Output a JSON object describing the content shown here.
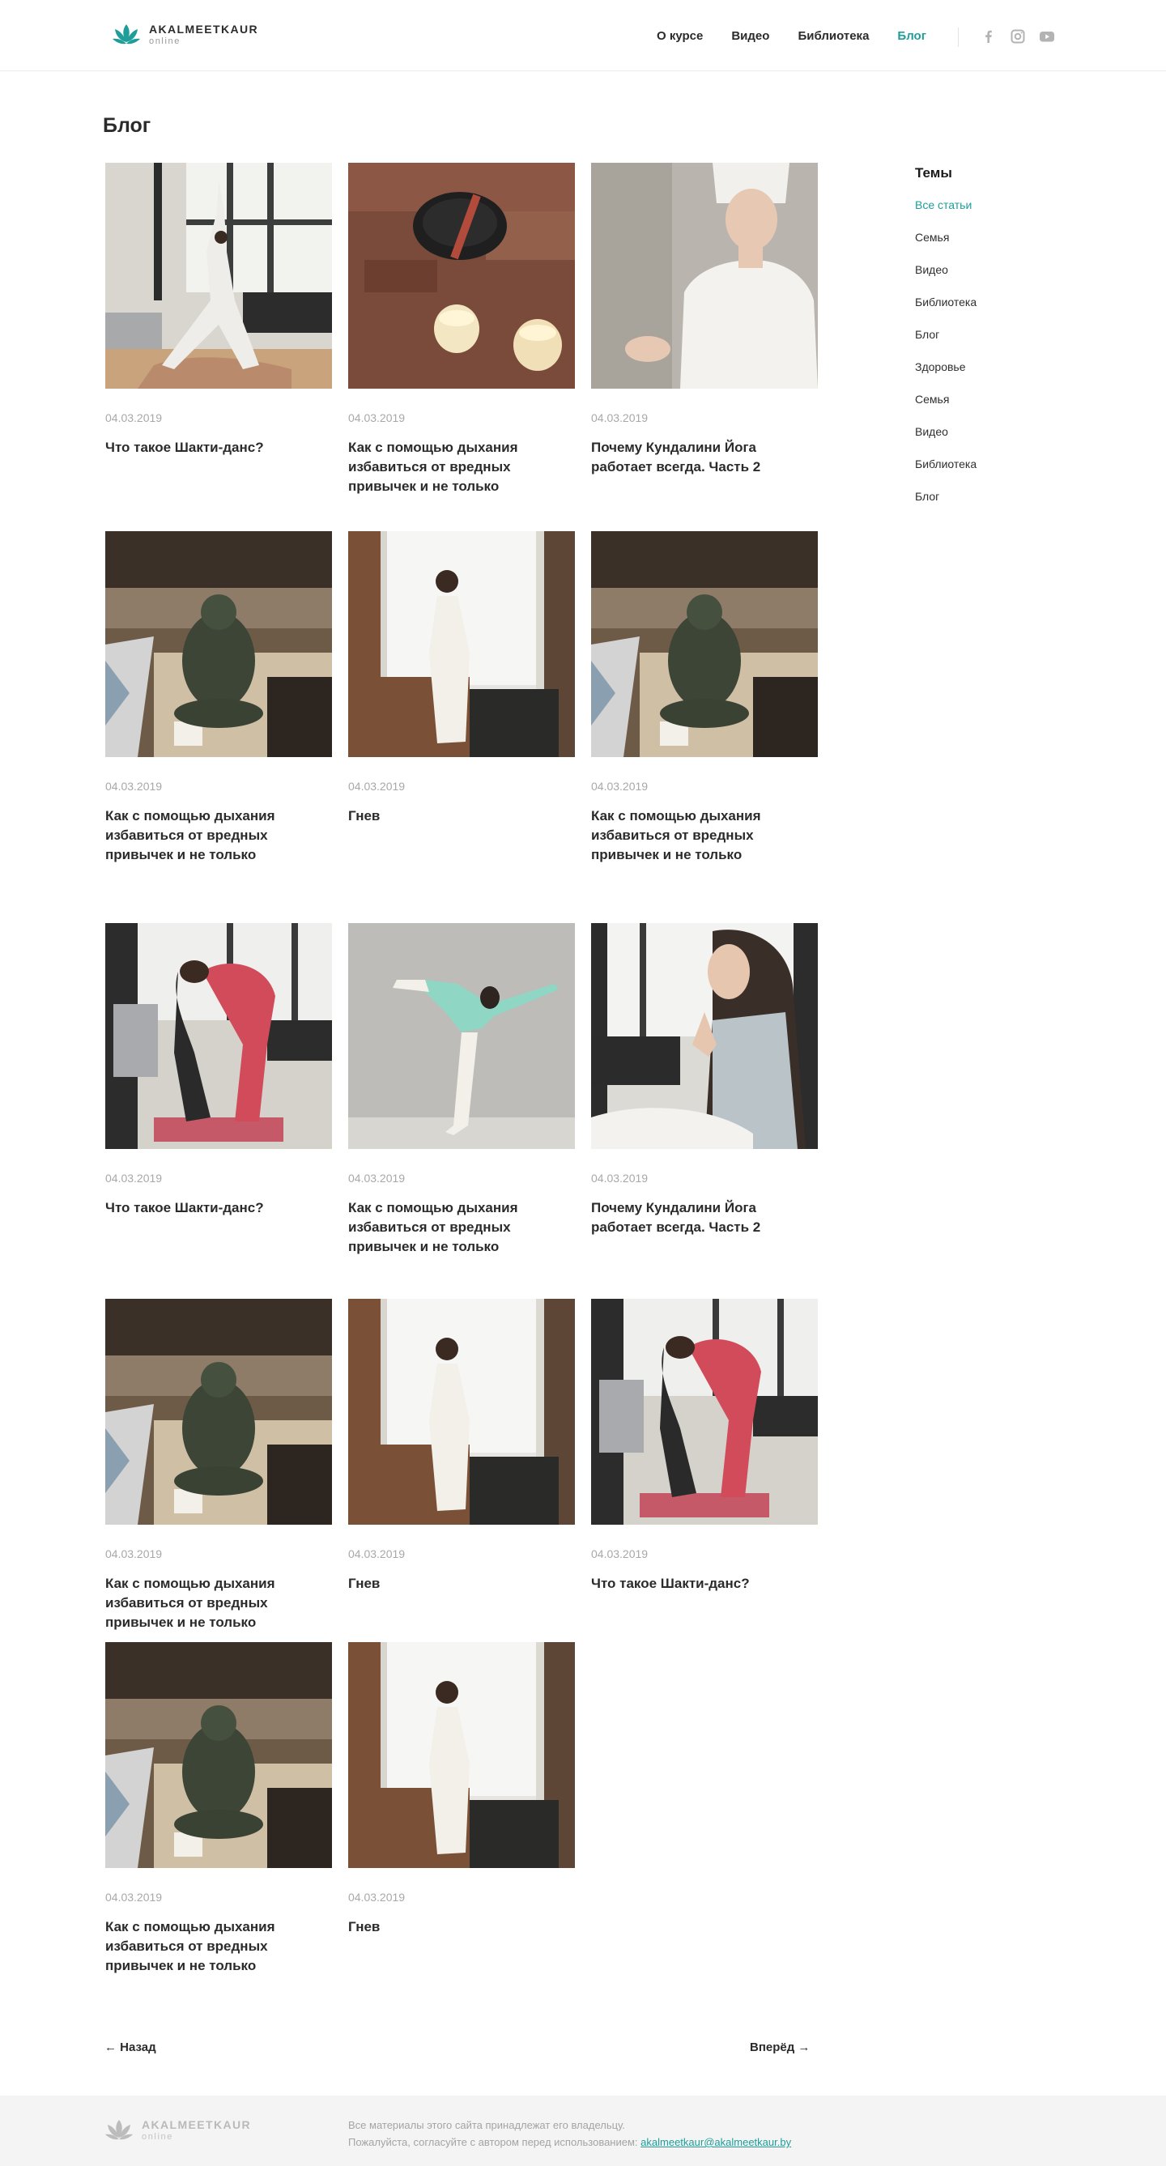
{
  "header": {
    "logo_name": "AKALMEETKAUR",
    "logo_sub": "online",
    "nav": [
      "О курсе",
      "Видео",
      "Библиотека",
      "Блог"
    ],
    "active_nav": "Блог",
    "social_icons": [
      "facebook-icon",
      "instagram-icon",
      "youtube-icon"
    ],
    "accent_color": "#1f9e99"
  },
  "page_title": "Блог",
  "posts": [
    {
      "date": "04.03.2019",
      "title": "Что такое Шакти-данс?",
      "image": "yoga-warrior-pose-photo"
    },
    {
      "date": "04.03.2019",
      "title": "Как с помощью дыхания избавиться от вредных привычек и не только",
      "image": "singing-bowl-candles-photo"
    },
    {
      "date": "04.03.2019",
      "title": "Почему Кундалини Йога работает всегда. Часть 2",
      "image": "woman-white-turban-photo"
    },
    {
      "date": "04.03.2019",
      "title": "Как с помощью дыхания избавиться от вредных привычек и не только",
      "image": "ganesha-statue-photo"
    },
    {
      "date": "04.03.2019",
      "title": "Гнев",
      "image": "woman-by-window-photo"
    },
    {
      "date": "04.03.2019",
      "title": "Как с помощью дыхания избавиться от вредных привычек и не только",
      "image": "ganesha-statue-photo"
    },
    {
      "date": "04.03.2019",
      "title": "Что такое Шакти-данс?",
      "image": "camel-pose-photo"
    },
    {
      "date": "04.03.2019",
      "title": "Как с помощью дыхания избавиться от вредных привычек и не только",
      "image": "dancer-pose-photo"
    },
    {
      "date": "04.03.2019",
      "title": "Почему Кундалини Йога работает всегда. Часть 2",
      "image": "prayer-hands-photo"
    },
    {
      "date": "04.03.2019",
      "title": "Как с помощью дыхания избавиться от вредных привычек и не только",
      "image": "ganesha-statue-photo"
    },
    {
      "date": "04.03.2019",
      "title": "Гнев",
      "image": "woman-by-window-photo"
    },
    {
      "date": "04.03.2019",
      "title": "Что такое Шакти-данс?",
      "image": "camel-pose-photo"
    },
    {
      "date": "04.03.2019",
      "title": "Как с помощью дыхания избавиться от вредных привычек и не только",
      "image": "ganesha-statue-photo"
    },
    {
      "date": "04.03.2019",
      "title": "Гнев",
      "image": "woman-by-window-photo"
    }
  ],
  "sidebar": {
    "title": "Темы",
    "items": [
      "Все статьи",
      "Семья",
      "Видео",
      "Библиотека",
      "Блог",
      "Здоровье",
      "Семья",
      "Видео",
      "Библиотека",
      "Блог"
    ],
    "active": "Все статьи"
  },
  "pager": {
    "prev": "← Назад",
    "next": "Вперёд →"
  },
  "footer": {
    "logo_name": "AKALMEETKAUR",
    "logo_sub": "online",
    "line1": "Все материалы этого сайта принадлежат его владельцу.",
    "line2": "Пожалуйста, согласуйте с автором перед использованием:",
    "email": "akalmeetkaur@akalmeetkaur.by"
  }
}
